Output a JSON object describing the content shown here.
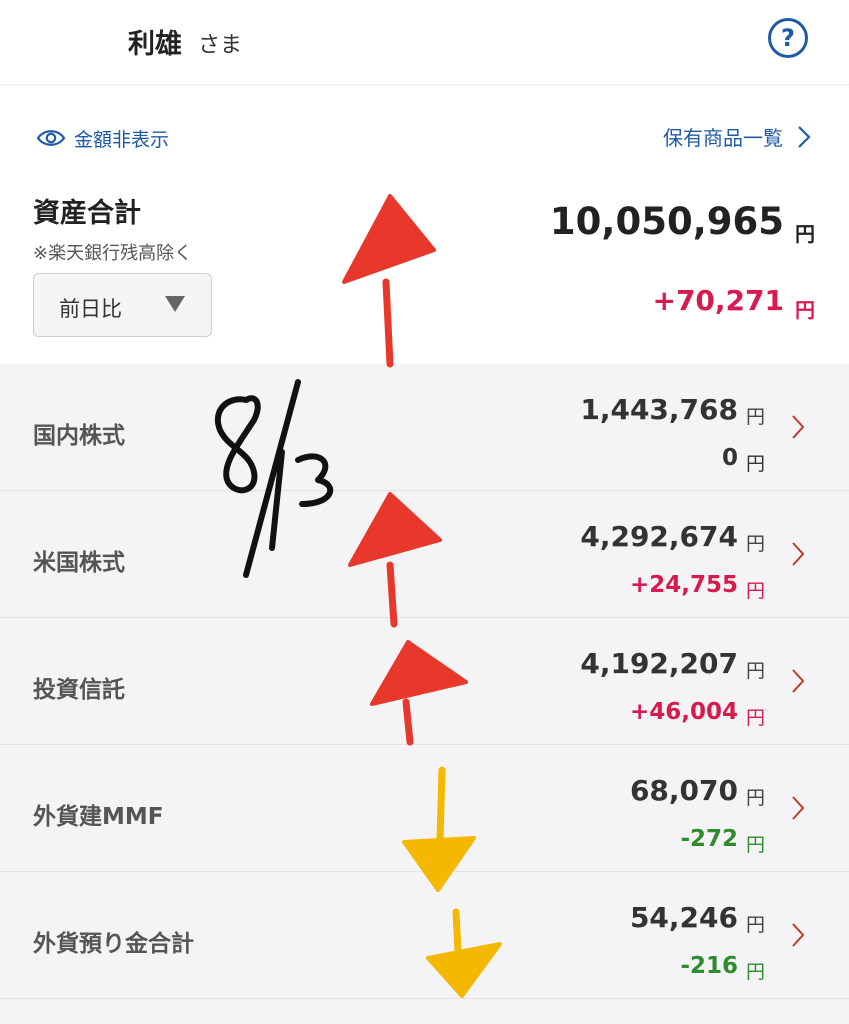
{
  "header": {
    "user_name": "利雄",
    "honorific": "さま",
    "help_icon": "?"
  },
  "summary": {
    "hide_amount_label": "金額非表示",
    "holdings_link_label": "保有商品一覧",
    "title": "資産合計",
    "note": "※楽天銀行残高除く",
    "compare_option": "前日比",
    "total_value": "10,050,965",
    "total_change": "+70,271",
    "currency": "円"
  },
  "assets": [
    {
      "label": "国内株式",
      "amount": "1,443,768",
      "change": "0",
      "change_color": "#333333"
    },
    {
      "label": "米国株式",
      "amount": "4,292,674",
      "change": "+24,755",
      "change_color": "#d81b4f"
    },
    {
      "label": "投資信託",
      "amount": "4,192,207",
      "change": "+46,004",
      "change_color": "#d81b4f"
    },
    {
      "label": "外貨建MMF",
      "amount": "68,070",
      "change": "-272",
      "change_color": "#2e8b2e"
    },
    {
      "label": "外貨預り金合計",
      "amount": "54,246",
      "change": "-216",
      "change_color": "#2e8b2e"
    }
  ],
  "annotation": {
    "handwritten_date": "8/13"
  },
  "colors": {
    "accent": "#1f5aa6",
    "positive": "#d81b4f",
    "negative": "#2e8b2e",
    "chevron": "#c0392b",
    "arrow_up": "#e8382b",
    "arrow_down": "#f5b800"
  }
}
